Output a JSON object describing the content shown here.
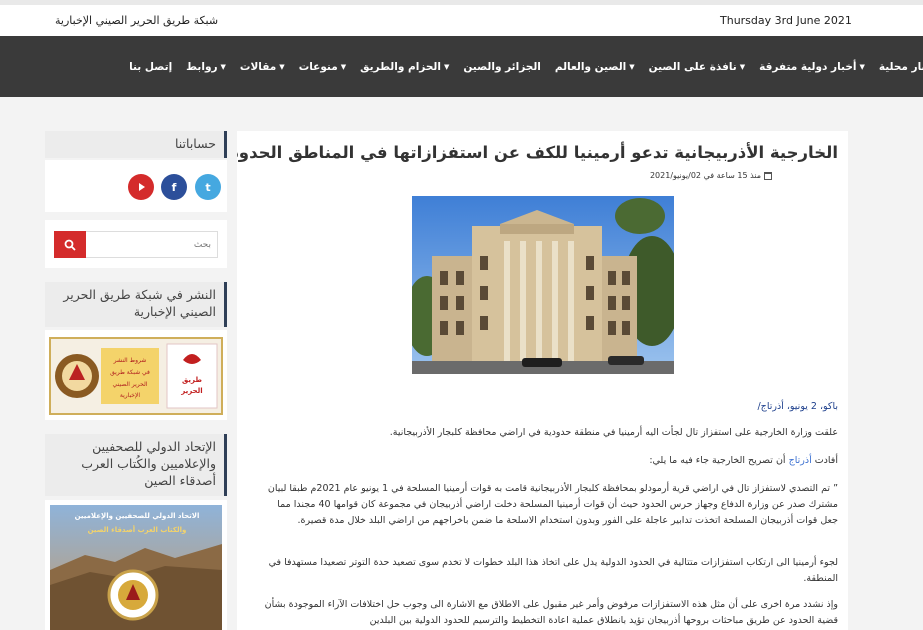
{
  "topbar": {
    "date": "Thursday 3rd June 2021",
    "site_name": "شبكة طريق الحرير الصيني الإخبارية"
  },
  "nav": {
    "items": [
      {
        "label": "أخبار محلية",
        "dropdown": false
      },
      {
        "label": "أخبار دولية متفرقة",
        "dropdown": true
      },
      {
        "label": "نافذة على الصين",
        "dropdown": true
      },
      {
        "label": "الصين والعالم",
        "dropdown": true
      },
      {
        "label": "الجزائر والصين",
        "dropdown": false
      },
      {
        "label": "الحزام والطريق",
        "dropdown": true
      },
      {
        "label": "منوعات",
        "dropdown": true
      },
      {
        "label": "مقالات",
        "dropdown": true
      },
      {
        "label": "روابط",
        "dropdown": true
      },
      {
        "label": "إتصل بنا",
        "dropdown": false
      }
    ]
  },
  "article": {
    "title": "الخارجية الأذربيجانية تدعو أرمينيا للكف عن استفزازاتها في المناطق الحدودية",
    "meta": "منذ 15 ساعة في 02/يونيو/2021",
    "dateline": "باكو، 2 يونيو، أذرتاج/",
    "p1": "علقت وزارة الخارجية على استفزاز تال لجأت اليه أرمينيا في منطقة حدودية في اراضي محافظة كلبجار الأذربيجانية.",
    "p2_prefix": "أفادت ",
    "p2_link": "أذرتاج",
    "p2_suffix": " أن تصريح الخارجية جاء فيه ما يلي:",
    "p3": "” تم التصدي لاستفزاز تال في اراضي قرية أرمودلو بمحافظة كلبجار الأذربيجانية قامت به قوات أرمينيا المسلحة في 1 يونيو عام 2021م طبقا لبيان مشترك صدر عن وزارة الدفاع وجهاز حرس الحدود حيث أن قوات أرمينيا المسلحة دخلت اراضي أذربيجان في مجموعة كان قوامها 40 مجندا مما جعل قوات أذربيجان المسلحة اتخذت تدابير عاجلة على الفور وبدون استخدام الاسلحة ما ضمن باخراجهم من اراضي البلد خلال مدة قصيرة.",
    "p4": "لجوء أرمينيا الى ارتكاب استفزازات متتالية في الحدود الدولية يدل على اتخاذ هذا البلد خطوات لا تخدم سوى تصعيد حدة التوتر تصعيدا مستهدفا في المنطقة.",
    "p5": "وإذ نشدد مرة اخرى على أن مثل هذه الاستفزازات مرفوض وأمر غير مقبول على الاطلاق مع الاشارة الى وجوب حل اختلافات الآراء الموجودة بشأن قضية الحدود عن طريق مباحثات بروحها أذربيجان تؤيد بانطلاق عملية اعادة التخطيط والترسيم للحدود الدولية بين البلدين"
  },
  "sidebar": {
    "accounts_title": "حساباتنا",
    "social": [
      {
        "name": "twitter",
        "glyph": "t"
      },
      {
        "name": "facebook",
        "glyph": "f"
      },
      {
        "name": "youtube",
        "glyph": ""
      }
    ],
    "search": {
      "placeholder": "بحث"
    },
    "publish_title": "النشر في شبكة طريق الحرير الصيني الإخبارية",
    "publish_banner_text": "شروط النشر في شبكة طريق الحرير الصيني الإخبارية",
    "publish_logo_text": "طريق الحرير",
    "union_title": "الإتحاد الدولي للصحفيين والإعلاميين والكُتاب العرب أصدقاء الصين",
    "union_banner_line1": "الاتحاد الدولي للصحفيين والإعلاميين",
    "union_banner_line2": "والكتاب العرب أصدقاء الصين"
  },
  "colors": {
    "nav_bg": "#3a3a3a",
    "accent_red": "#d42b2b",
    "twitter": "#45a8e0",
    "facebook": "#2c4f9a",
    "youtube": "#d42b2b",
    "sidebar_border": "#2f3f57"
  }
}
